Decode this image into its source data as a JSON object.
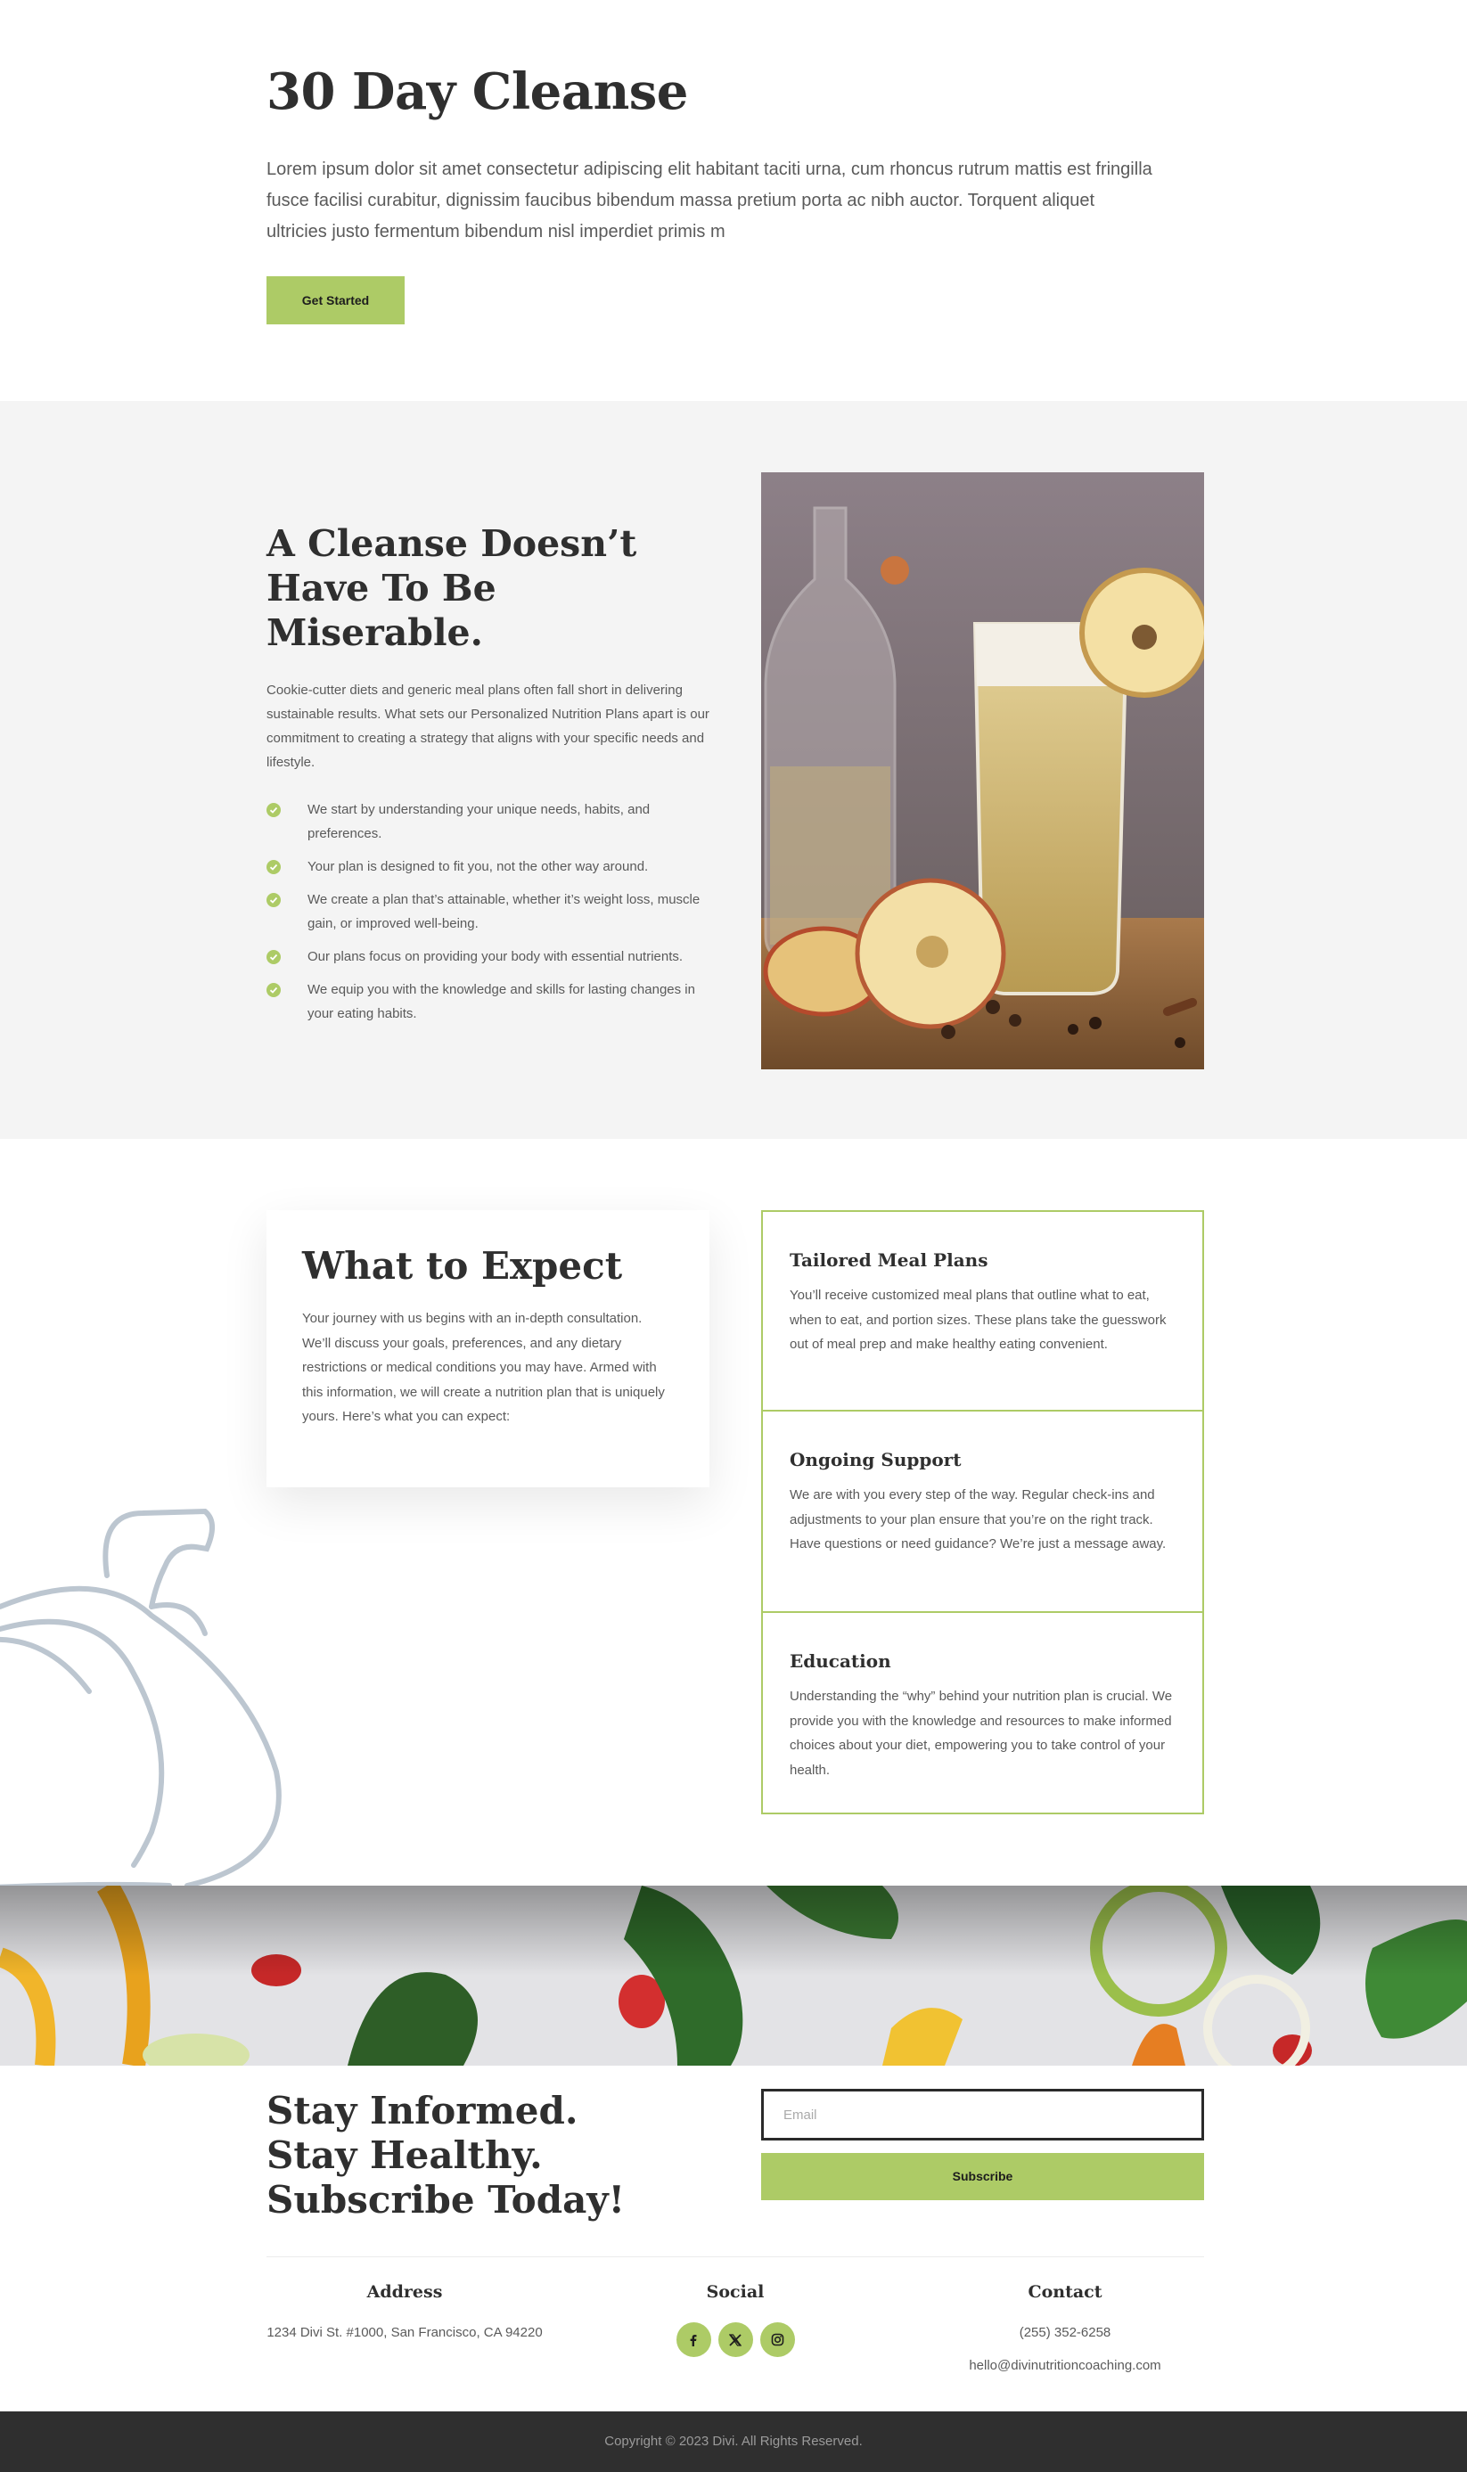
{
  "hero": {
    "title": "30 Day Cleanse",
    "body": "Lorem ipsum dolor sit amet consectetur adipiscing elit habitant taciti urna, cum rhoncus rutrum mattis est fringilla fusce facilisi curabitur, dignissim faucibus bibendum massa pretium porta ac nibh auctor. Torquent aliquet ultricies justo fermentum bibendum nisl imperdiet primis m",
    "button_label": "Get Started"
  },
  "cleanse": {
    "title": "A Cleanse Doesn’t Have To Be Miserable.",
    "intro": "Cookie-cutter diets and generic meal plans often fall short in delivering sustainable results. What sets our Personalized Nutrition Plans apart is our commitment to creating a strategy that aligns with your specific needs and lifestyle.",
    "items": [
      {
        "icon": "check-circle-icon",
        "text": "We start by understanding your unique needs, habits, and preferences."
      },
      {
        "icon": "check-circle-icon",
        "text": "Your plan is designed to fit you, not the other way around."
      },
      {
        "icon": "check-circle-icon",
        "text": "We create a plan that’s attainable, whether it’s weight loss, muscle gain, or improved well-being."
      },
      {
        "icon": "check-circle-icon",
        "text": "Our plans focus on providing your body with essential nutrients."
      },
      {
        "icon": "check-circle-icon",
        "text": "We equip you with the knowledge and skills for lasting changes in your eating habits."
      }
    ]
  },
  "expect": {
    "title": "What to Expect",
    "body": "Your journey with us begins with an in-depth consultation. We’ll discuss your goals, preferences, and any dietary restrictions or medical conditions you may have. Armed with this information, we will create a nutrition plan that is uniquely yours. Here’s what you can expect:",
    "features": [
      {
        "title": "Tailored Meal Plans",
        "text": "You’ll receive customized meal plans that outline what to eat, when to eat, and portion sizes. These plans take the guesswork out of meal prep and make healthy eating convenient."
      },
      {
        "title": "Ongoing Support",
        "text": "We are with you every step of the way. Regular check-ins and adjustments to your plan ensure that you’re on the right track. Have questions or need guidance? We’re just a message away."
      },
      {
        "title": "Education",
        "text": "Understanding the “why” behind your nutrition plan is crucial. We provide you with the knowledge and resources to make informed choices about your diet, empowering you to take control of your health."
      }
    ]
  },
  "subscribe": {
    "title": "Stay Informed. Stay Healthy. Subscribe Today!",
    "email_placeholder": "Email",
    "button_label": "Subscribe"
  },
  "info": {
    "address_title": "Address",
    "address": "1234 Divi St. #1000, San Francisco, CA 94220",
    "social_title": "Social",
    "social": [
      {
        "icon": "facebook-icon"
      },
      {
        "icon": "x-twitter-icon"
      },
      {
        "icon": "instagram-icon"
      }
    ],
    "contact_title": "Contact",
    "phone": "(255) 352-6258",
    "email": "hello@divinutritioncoaching.com"
  },
  "footer": {
    "copyright": "Copyright © 2023 Divi. All Rights Reserved."
  },
  "colors": {
    "accent": "#adcb66",
    "section_gray": "#f4f4f4",
    "heading": "#2f2f2f",
    "footer_bg": "#2f2f2f",
    "pumpkin_outline": "#bcc6d0"
  }
}
